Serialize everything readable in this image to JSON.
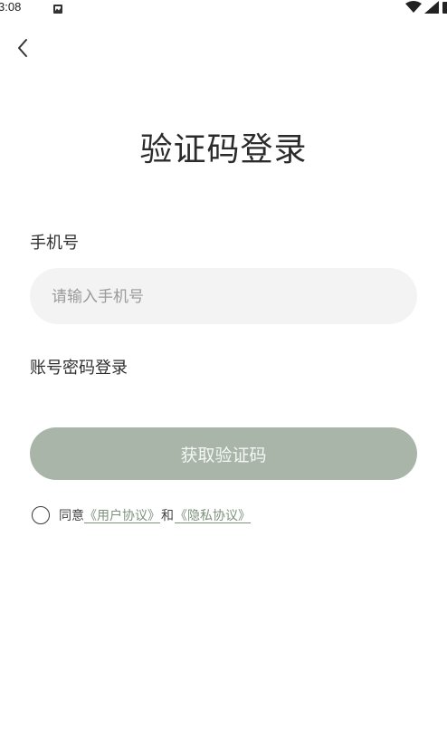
{
  "status_bar": {
    "time": "3:08",
    "notification_icon": "notification-icon",
    "wifi_icon": "wifi-icon",
    "signal_icon": "signal-icon",
    "battery_icon": "battery-icon"
  },
  "nav": {
    "back_icon": "chevron-left-icon"
  },
  "page": {
    "title": "验证码登录"
  },
  "form": {
    "phone_label": "手机号",
    "phone_placeholder": "请输入手机号",
    "phone_value": "",
    "password_login_label": "账号密码登录",
    "get_code_label": "获取验证码"
  },
  "agreement": {
    "agree_text": "同意",
    "user_agreement": "《用户协议》",
    "and_text": "和",
    "privacy_policy": "《隐私协议》",
    "checked": false
  },
  "colors": {
    "button_bg": "#a9b5a9",
    "link": "#7d917d",
    "input_bg": "#f3f3f3"
  }
}
